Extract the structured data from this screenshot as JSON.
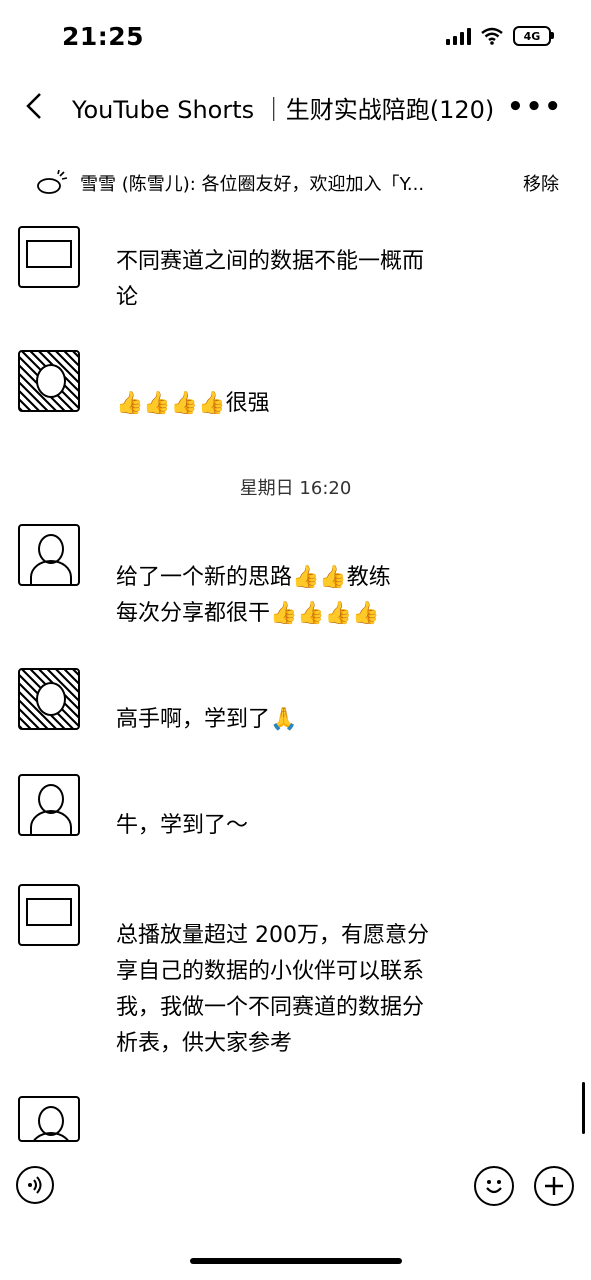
{
  "status": {
    "time": "21:25",
    "network": "4G"
  },
  "header": {
    "back_icon": "chevron-left-icon",
    "title": "YouTube Shorts ｜生财实战陪跑(120)",
    "more_icon": "more-icon"
  },
  "notice": {
    "icon": "announcement-icon",
    "text": "雪雪 (陈雪儿): 各位圈友好，欢迎加入「Y...",
    "remove_label": "移除"
  },
  "messages": [
    {
      "avatar": "avatar-box",
      "text_line1": "不同赛道之间的数据不能一概而",
      "text_line2": "论"
    },
    {
      "avatar": "avatar-photo",
      "text": "👍👍👍👍很强"
    },
    {
      "avatar": "avatar-couple",
      "text_line1": "给了一个新的思路👍👍教练",
      "text_line2": "每次分享都很干👍👍👍👍"
    },
    {
      "avatar": "avatar-photo",
      "text": "高手啊，学到了🙏"
    },
    {
      "avatar": "avatar-person",
      "text": "牛，学到了～"
    },
    {
      "avatar": "avatar-box",
      "text_line1": "总播放量超过 200万，有愿意分",
      "text_line2": "享自己的数据的小伙伴可以联系",
      "text_line3": "我，我做一个不同赛道的数据分",
      "text_line4": "析表，供大家参考"
    }
  ],
  "time_divider": "星期日 16:20",
  "composer": {
    "voice_icon": "voice-icon",
    "emoji_icon": "emoji-icon",
    "plus_icon": "plus-icon"
  }
}
